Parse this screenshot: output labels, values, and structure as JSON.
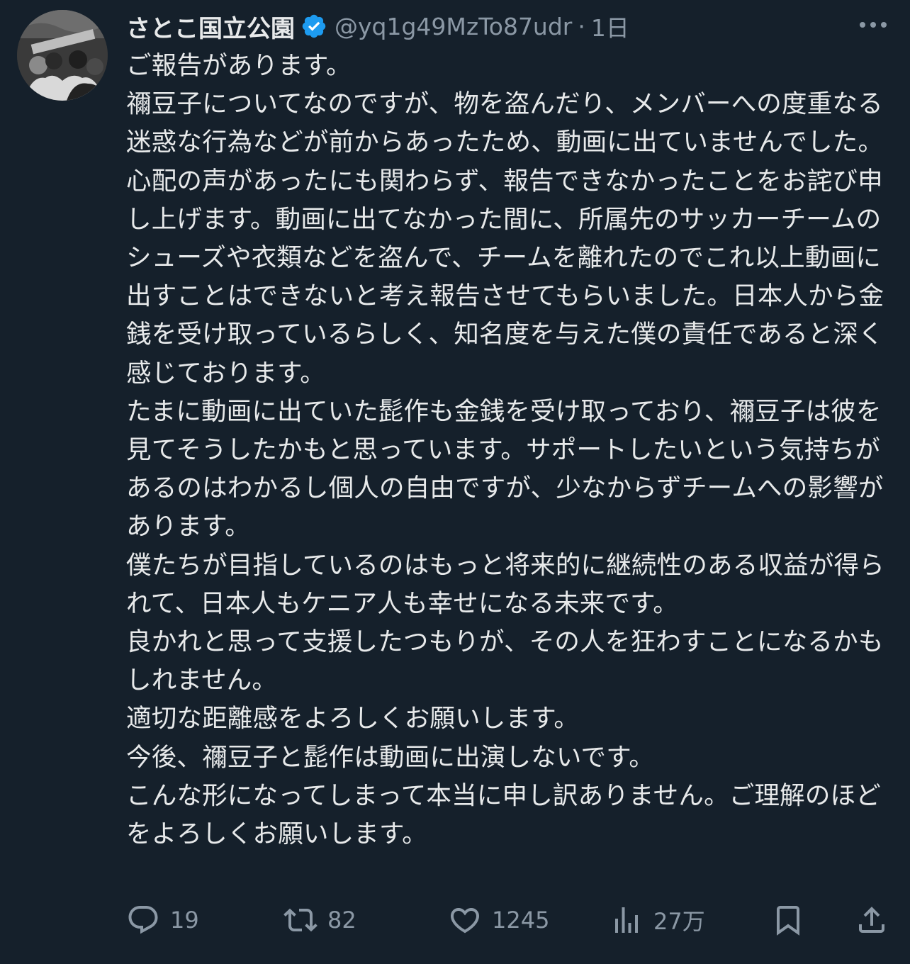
{
  "tweet": {
    "display_name": "さとこ国立公園",
    "handle": "@yq1g49MzTo87udr",
    "separator": "·",
    "time": "1日",
    "paragraphs": [
      "ご報告があります。",
      "禰豆子についてなのですが、物を盗んだり、メンバーへの度重なる迷惑な行為などが前からあったため、動画に出ていませんでした。心配の声があったにも関わらず、報告できなかったことをお詫び申し上げます。動画に出てなかった間に、所属先のサッカーチームのシューズや衣類などを盗んで、チームを離れたのでこれ以上動画に出すことはできないと考え報告させてもらいました。日本人から金銭を受け取っているらしく、知名度を与えた僕の責任であると深く感じております。",
      "たまに動画に出ていた髭作も金銭を受け取っており、禰豆子は彼を見てそうしたかもと思っています。サポートしたいという気持ちがあるのはわかるし個人の自由ですが、少なからずチームへの影響があります。",
      "僕たちが目指しているのはもっと将来的に継続性のある収益が得られて、日本人もケニア人も幸せになる未来です。",
      "良かれと思って支援したつもりが、その人を狂わすことになるかもしれません。",
      "適切な距離感をよろしくお願いします。",
      "今後、禰豆子と髭作は動画に出演しないです。",
      "こんな形になってしまって本当に申し訳ありません。ご理解のほどをよろしくお願いします。"
    ]
  },
  "actions": {
    "replies": "19",
    "retweets": "82",
    "likes": "1245",
    "views": "27万"
  },
  "icons": {
    "verified": "verified-badge-icon",
    "more": "more-options-icon",
    "reply": "reply-icon",
    "retweet": "retweet-icon",
    "like": "heart-icon",
    "views": "views-bar-chart-icon",
    "bookmark": "bookmark-icon",
    "share": "share-icon"
  },
  "colors": {
    "background": "#15202b",
    "text": "#e7e9ea",
    "muted": "#8b98a5",
    "verified": "#1d9bf0"
  }
}
